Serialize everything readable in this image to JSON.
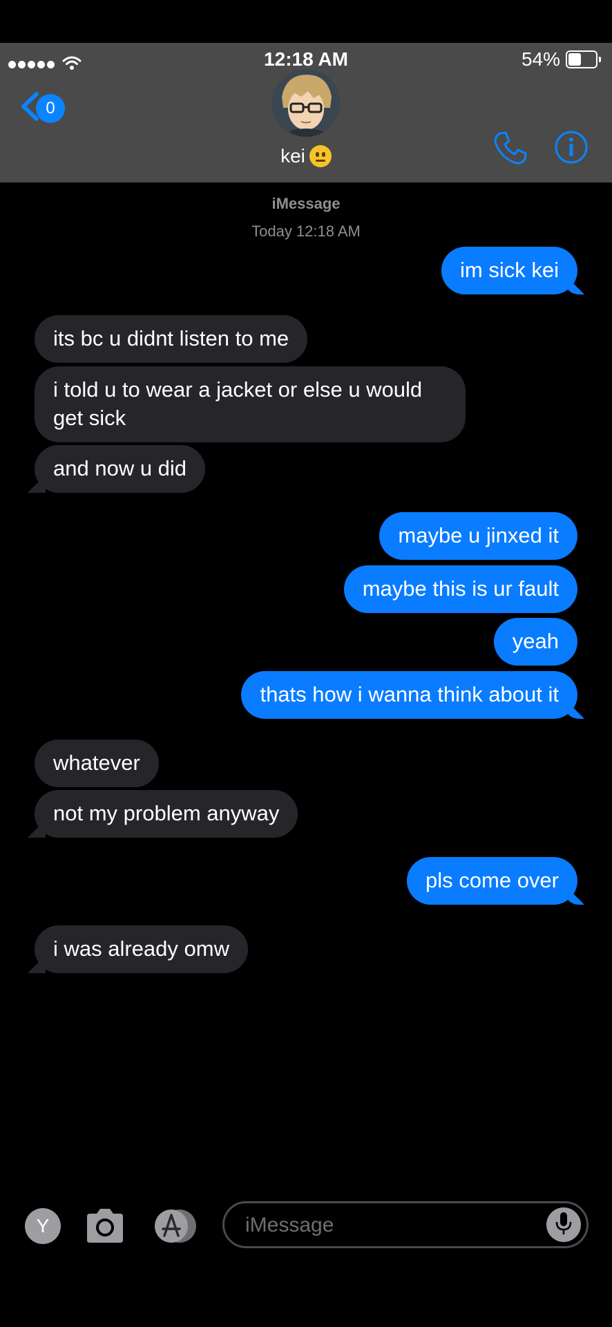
{
  "status_bar": {
    "time": "12:18 AM",
    "battery": "54%",
    "battery_level": 0.54,
    "signal_dots": 5
  },
  "header": {
    "back_badge": "0",
    "contact_name": "kei",
    "contact_emoji": "neutral-face",
    "icons": [
      "back-chevron-icon",
      "phone-icon",
      "info-icon"
    ]
  },
  "thread": {
    "service": "iMessage",
    "timestamp": "Today 12:18 AM",
    "messages": [
      {
        "from": "me",
        "text": "im sick kei"
      },
      {
        "from": "them",
        "text": "its bc u didnt listen to me"
      },
      {
        "from": "them",
        "text": "i told u to wear a jacket or else u would get sick"
      },
      {
        "from": "them",
        "text": "and now u did"
      },
      {
        "from": "me",
        "text": "maybe u jinxed it"
      },
      {
        "from": "me",
        "text": "maybe this is ur fault"
      },
      {
        "from": "me",
        "text": "yeah"
      },
      {
        "from": "me",
        "text": "thats how i wanna think about it"
      },
      {
        "from": "them",
        "text": "whatever"
      },
      {
        "from": "them",
        "text": "not my problem anyway"
      },
      {
        "from": "me",
        "text": "pls come over"
      },
      {
        "from": "them",
        "text": "i was already omw"
      }
    ]
  },
  "composer": {
    "app_button_label": "Y",
    "placeholder": "iMessage"
  },
  "colors": {
    "sent_bubble": "#0a7cff",
    "received_bubble": "#26252a",
    "header_bg": "#4a4a4a",
    "accent": "#0a84ff"
  }
}
